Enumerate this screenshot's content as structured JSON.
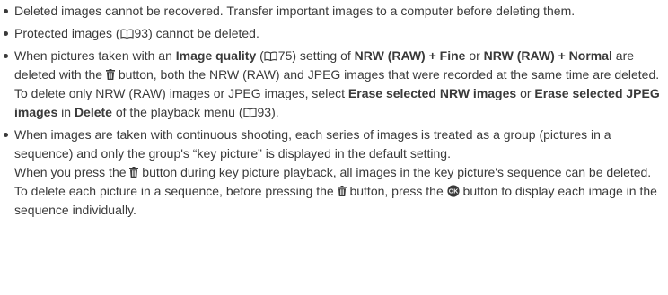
{
  "notes": {
    "n1": "Deleted images cannot be recovered. Transfer important images to a computer before deleting them.",
    "n2": {
      "a": "Protected images (",
      "ref": "93",
      "b": ") cannot be deleted."
    },
    "n3": {
      "t1": "When pictures taken with an ",
      "image_quality": "Image quality",
      "t2": " (",
      "ref1": "75",
      "t3": ") setting of ",
      "nrw_fine": "NRW (RAW) + Fine",
      "t4": " or ",
      "nrw_normal": "NRW (RAW) + Normal",
      "t5": " are deleted with the ",
      "t6": " button, both the NRW (RAW) and JPEG images that were recorded at the same time are deleted.",
      "t7": "To delete only NRW (RAW) images or JPEG images, select ",
      "erase_nrw": "Erase selected NRW images",
      "t8": " or ",
      "erase_jpeg": "Erase selected JPEG images",
      "t9": " in ",
      "delete": "Delete",
      "t10": " of the playback menu (",
      "ref2": "93",
      "t11": ")."
    },
    "n4": {
      "t1": "When images are taken with continuous shooting, each series of images is treated as a group (pictures in a sequence) and only the group's “key picture” is displayed in the default setting.",
      "t2": "When you press the ",
      "t3": " button during key picture playback, all images in the key picture's sequence can be deleted.",
      "t4": "To delete each picture in a sequence, before pressing the ",
      "t5": " button, press the ",
      "t6": " button to display each image in the sequence individually."
    }
  },
  "icons": {
    "reference": "book-reference-icon",
    "delete": "trash-icon",
    "ok": "ok-button-icon"
  }
}
